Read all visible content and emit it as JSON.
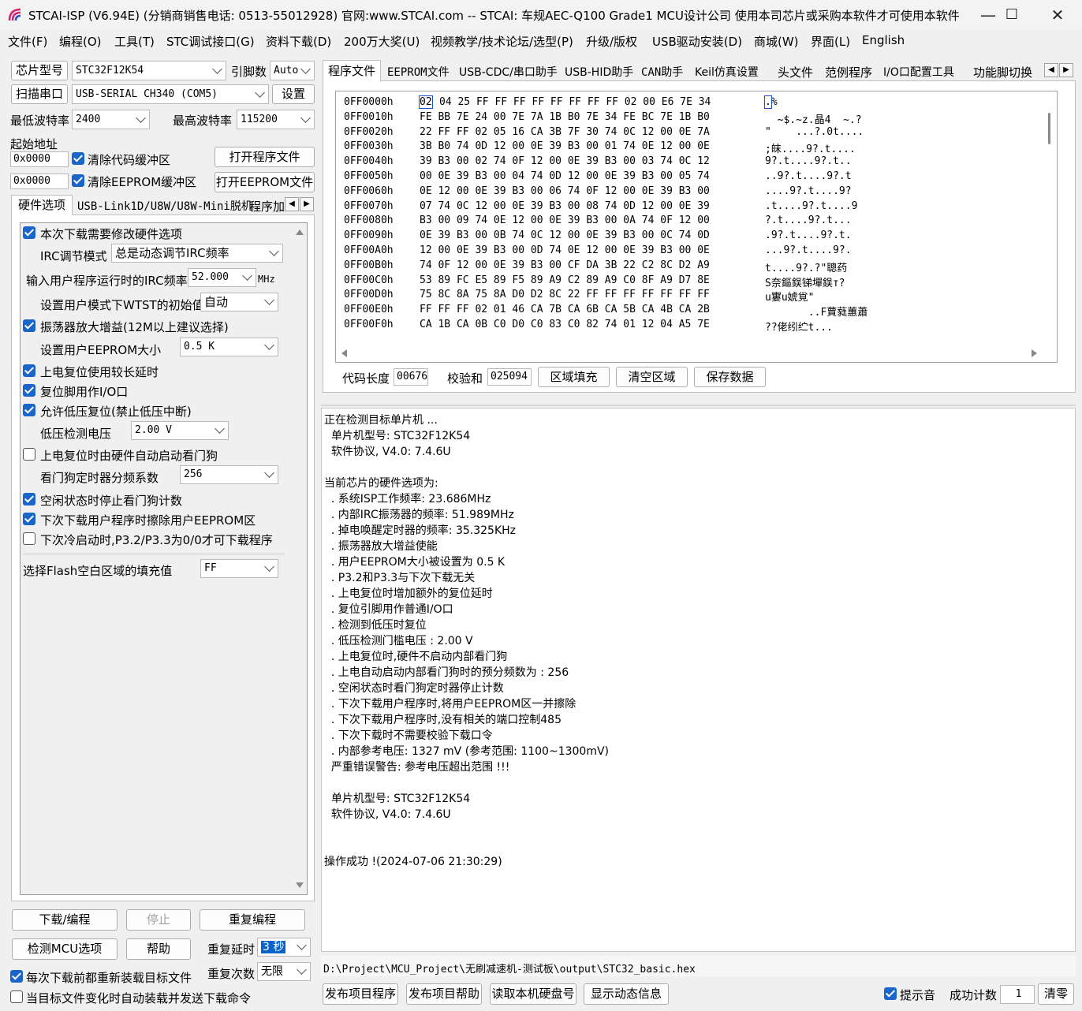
{
  "window": {
    "title": "STCAI-ISP (V6.94E) (分销商销售电话: 0513-55012928) 官网:www.STCAI.com  -- STCAI: 车规AEC-Q100 Grade1 MCU设计公司 使用本司芯片或采购本软件才可使用本软件",
    "minimize": "—",
    "maximize": "☐",
    "close": "✕"
  },
  "menu": [
    "文件(F)",
    "编程(O)",
    "工具(T)",
    "STC调试接口(G)",
    "资料下载(D)",
    "200万大奖(U)",
    "视频教学/技术论坛/选型(P)",
    "升级/版权",
    "USB驱动安装(D)",
    "商城(W)",
    "界面(L)",
    "English"
  ],
  "left": {
    "chip_label": "芯片型号",
    "chip_value": "STC32F12K54",
    "pins_label": "引脚数",
    "pins_value": "Auto",
    "scan_label": "扫描串口",
    "port_value": "USB-SERIAL CH340 (COM5)",
    "settings_label": "设置",
    "min_baud_label": "最低波特率",
    "min_baud_value": "2400",
    "max_baud_label": "最高波特率",
    "max_baud_value": "115200",
    "start_addr_label": "起始地址",
    "addr1": "0x0000",
    "clear_code_label": "清除代码缓冲区",
    "open_prog_label": "打开程序文件",
    "addr2": "0x0000",
    "clear_eeprom_label": "清除EEPROM缓冲区",
    "open_eeprom_label": "打开EEPROM文件",
    "tabs": [
      "硬件选项",
      "USB-Link1D/U8W/U8W-Mini脱机",
      "程序加"
    ],
    "options": {
      "opt1": "本次下载需要修改硬件选项",
      "irc_mode_label": "IRC调节模式",
      "irc_mode_value": "总是动态调节IRC频率",
      "irc_freq_label": "输入用户程序运行时的IRC频率",
      "irc_freq_value": "52.000",
      "irc_freq_unit": "MHz",
      "wtst_label": "设置用户模式下WTST的初始值",
      "wtst_value": "自动",
      "opt_amp": "振荡器放大增益(12M以上建议选择)",
      "eeprom_size_label": "设置用户EEPROM大小",
      "eeprom_size_value": "0.5 K",
      "opt_por": "上电复位使用较长延时",
      "opt_reset_io": "复位脚用作I/O口",
      "opt_lvr": "允许低压复位(禁止低压中断)",
      "lvd_label": "低压检测电压",
      "lvd_value": "2.00 V",
      "opt_wdt": "上电复位时由硬件自动启动看门狗",
      "wdt_div_label": "看门狗定时器分频系数",
      "wdt_div_value": "256",
      "opt_idle": "空闲状态时停止看门狗计数",
      "opt_erase": "下次下载用户程序时擦除用户EEPROM区",
      "opt_p3": "下次冷启动时,P3.2/P3.3为0/0才可下载程序",
      "fill_label": "选择Flash空白区域的填充值",
      "fill_value": "FF"
    },
    "download_label": "下载/编程",
    "stop_label": "停止",
    "reprog_label": "重复编程",
    "detect_label": "检测MCU选项",
    "help_label": "帮助",
    "repeat_delay_label": "重复延时",
    "repeat_delay_value": "3 秒",
    "repeat_count_label": "重复次数",
    "repeat_count_value": "无限",
    "reload_label": "每次下载前都重新装载目标文件",
    "autoload_label": "当目标文件变化时自动装载并发送下载命令"
  },
  "right": {
    "tabs": [
      "程序文件",
      "EEPROM文件",
      "USB-CDC/串口助手",
      "USB-HID助手",
      "CAN助手",
      "Keil仿真设置",
      "头文件",
      "范例程序",
      "I/O口配置工具",
      "功能脚切换"
    ],
    "hex_rows": [
      {
        "addr": "0FF0000h",
        "bytes": "02 04 25 FF FF FF FF FF FF FF FF 02 00 E6 7E 34",
        "ascii": ".%"
      },
      {
        "addr": "0FF0010h",
        "bytes": "FE BB 7E 24 00 7E 7A 1B B0 7E 34 FE BC 7E 1B B0",
        "ascii": "  ~$.~z.晶4  ~.?"
      },
      {
        "addr": "0FF0020h",
        "bytes": "22 FF FF 02 05 16 CA 3B 7F 30 74 0C 12 00 0E 7A",
        "ascii": "\"    ...?.0t...."
      },
      {
        "addr": "0FF0030h",
        "bytes": "3B B0 74 0D 12 00 0E 39 B3 00 01 74 0E 12 00 0E",
        "ascii": ";皌....9?.t...."
      },
      {
        "addr": "0FF0040h",
        "bytes": "39 B3 00 02 74 0F 12 00 0E 39 B3 00 03 74 0C 12",
        "ascii": "9?.t....9?.t.."
      },
      {
        "addr": "0FF0050h",
        "bytes": "00 0E 39 B3 00 04 74 0D 12 00 0E 39 B3 00 05 74",
        "ascii": "..9?.t....9?.t"
      },
      {
        "addr": "0FF0060h",
        "bytes": "0E 12 00 0E 39 B3 00 06 74 0F 12 00 0E 39 B3 00",
        "ascii": "....9?.t....9?"
      },
      {
        "addr": "0FF0070h",
        "bytes": "07 74 0C 12 00 0E 39 B3 00 08 74 0D 12 00 0E 39",
        "ascii": ".t....9?.t....9"
      },
      {
        "addr": "0FF0080h",
        "bytes": "B3 00 09 74 0E 12 00 0E 39 B3 00 0A 74 0F 12 00",
        "ascii": "?.t....9?.t..."
      },
      {
        "addr": "0FF0090h",
        "bytes": "0E 39 B3 00 0B 74 0C 12 00 0E 39 B3 00 0C 74 0D",
        "ascii": ".9?.t....9?.t."
      },
      {
        "addr": "0FF00A0h",
        "bytes": "12 00 0E 39 B3 00 0D 74 0E 12 00 0E 39 B3 00 0E",
        "ascii": "...9?.t....9?."
      },
      {
        "addr": "0FF00B0h",
        "bytes": "74 0F 12 00 0E 39 B3 00 CF DA 3B 22 C2 8C D2 A9",
        "ascii": "t....9?.?\"聰药"
      },
      {
        "addr": "0FF00C0h",
        "bytes": "53 89 FC E5 89 F5 89 A9 C2 89 A9 C0 8F A9 D7 8E",
        "ascii": "S奈鏂鋘锑墠鋘т?"
      },
      {
        "addr": "0FF00D0h",
        "bytes": "75 8C 8A 75 8A D0 D2 8C 22 FF FF FF FF FF FF FF",
        "ascii": "u寠u婋覍\""
      },
      {
        "addr": "0FF00E0h",
        "bytes": "FF FF FF 02 01 46 CA 7B CA 6B CA 5B CA 4B CA 2B",
        "ascii": "       ..F蕒蕤蕙蕭"
      },
      {
        "addr": "0FF00F0h",
        "bytes": "CA 1B CA 0B C0 D0 C0 83 C0 82 74 01 12 04 A5 7E",
        "ascii": "??佬纼纻t..."
      }
    ],
    "code_len_label": "代码长度",
    "code_len_value": "00676",
    "checksum_label": "校验和",
    "checksum_value": "025094",
    "fill_area_label": "区域填充",
    "clear_area_label": "清空区域",
    "save_data_label": "保存数据",
    "log_lines": [
      "正在检测目标单片机 ...",
      "  单片机型号: STC32F12K54",
      "  软件协议, V4.0: 7.4.6U",
      "",
      "当前芯片的硬件选项为:",
      "  . 系统ISP工作频率: 23.686MHz",
      "  . 内部IRC振荡器的频率: 51.989MHz",
      "  . 掉电唤醒定时器的频率: 35.325KHz",
      "  . 振荡器放大增益使能",
      "  . 用户EEPROM大小被设置为 0.5 K",
      "  . P3.2和P3.3与下次下载无关",
      "  . 上电复位时增加额外的复位延时",
      "  . 复位引脚用作普通I/O口",
      "  . 检测到低压时复位",
      "  . 低压检测门槛电压 : 2.00 V",
      "  . 上电复位时,硬件不启动内部看门狗",
      "  . 上电自动启动内部看门狗时的预分频数为 : 256",
      "  . 空闲状态时看门狗定时器停止计数",
      "  . 下次下载用户程序时,将用户EEPROM区一并擦除",
      "  . 下次下载用户程序时,没有相关的端口控制485",
      "  . 下次下载时不需要校验下载口令",
      "  . 内部参考电压: 1327 mV (参考范围: 1100~1300mV)",
      "  严重错误警告: 参考电压超出范围 !!!",
      "",
      "  单片机型号: STC32F12K54",
      "  软件协议, V4.0: 7.4.6U",
      "",
      "",
      "操作成功 !(2024-07-06 21:30:29)"
    ],
    "file_path": "D:\\Project\\MCU_Project\\无刷减速机-测试板\\output\\STC32_basic.hex",
    "publish_prog_label": "发布项目程序",
    "publish_help_label": "发布项目帮助",
    "read_disk_label": "读取本机硬盘号",
    "show_dynamic_label": "显示动态信息",
    "beep_label": "提示音",
    "success_count_label": "成功计数",
    "success_count_value": "1",
    "clear_label": "清零"
  }
}
